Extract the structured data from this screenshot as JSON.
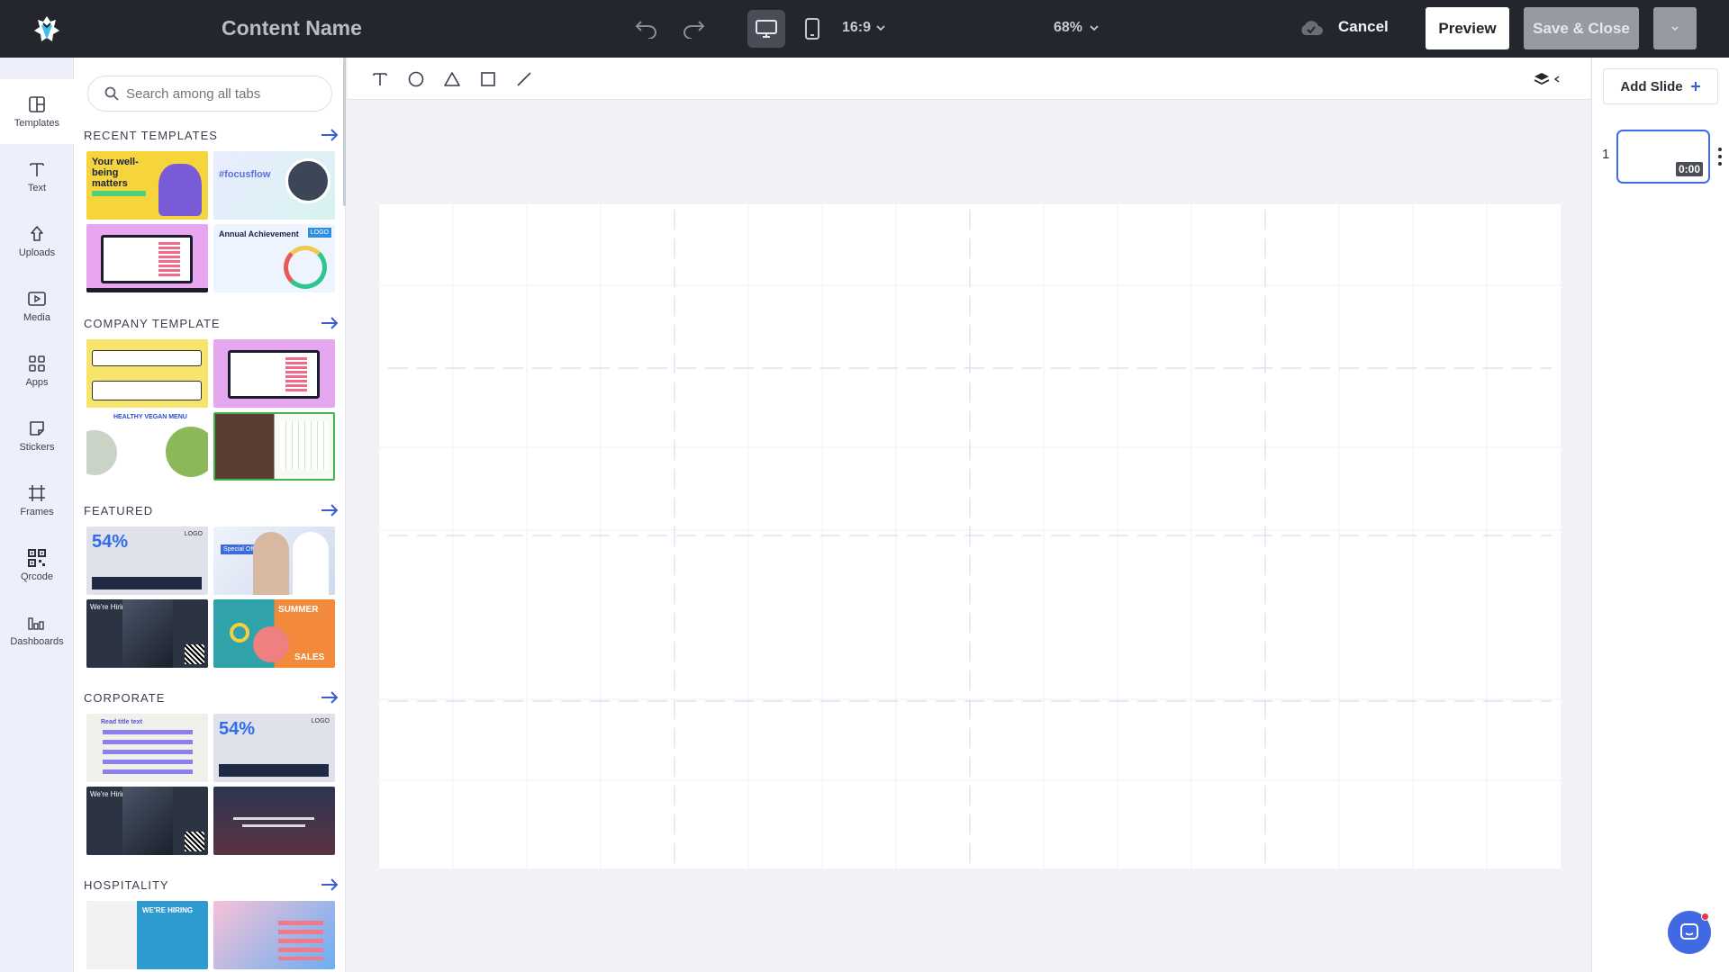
{
  "topbar": {
    "content_name": "Content Name",
    "ratio": "16:9",
    "zoom": "68%",
    "cancel": "Cancel",
    "preview": "Preview",
    "save_close": "Save & Close"
  },
  "rail": {
    "items": [
      {
        "label": "Templates"
      },
      {
        "label": "Text"
      },
      {
        "label": "Uploads"
      },
      {
        "label": "Media"
      },
      {
        "label": "Apps"
      },
      {
        "label": "Stickers"
      },
      {
        "label": "Frames"
      },
      {
        "label": "Qrcode"
      },
      {
        "label": "Dashboards"
      }
    ]
  },
  "panel": {
    "search_placeholder": "Search among all tabs",
    "sections": [
      {
        "title": "RECENT TEMPLATES"
      },
      {
        "title": "COMPANY TEMPLATE"
      },
      {
        "title": "FEATURED"
      },
      {
        "title": "CORPORATE"
      },
      {
        "title": "HOSPITALITY"
      }
    ],
    "thumb_text": {
      "wellbeing": "Your well-being matters",
      "focusflow": "#focusflow",
      "annual": "Annual Achievement",
      "logo": "LOGO",
      "pct": "54%",
      "hiring": "We're Hiring",
      "special": "Special Offer",
      "summer": "SUMMER",
      "sales": "SALES",
      "read": "Read title text",
      "wehiring": "WE'RE HIRING",
      "healthy": "HEALTHY VEGAN MENU"
    }
  },
  "right": {
    "add_slide": "Add Slide",
    "slide_number": "1",
    "duration": "0:00"
  },
  "colors": {
    "topbar": "#24262d",
    "accent": "#3d6cf0",
    "chat": "#4169e1"
  }
}
